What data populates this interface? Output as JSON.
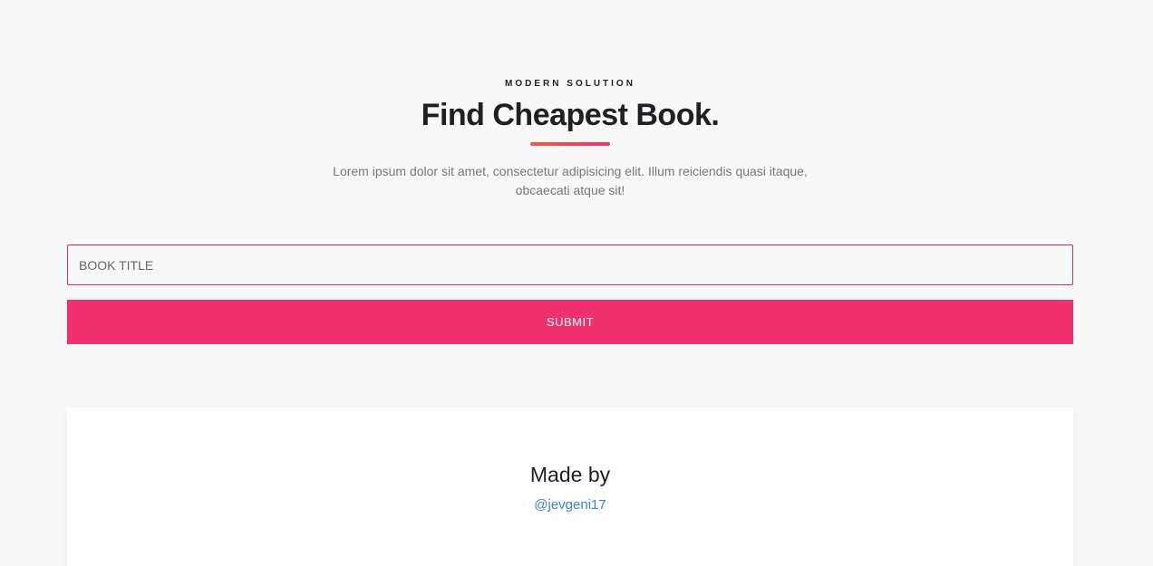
{
  "header": {
    "eyebrow": "MODERN SOLUTION",
    "title": "Find Cheapest Book.",
    "description": "Lorem ipsum dolor sit amet, consectetur adipisicing elit. Illum reiciendis quasi itaque, obcaecati atque sit!"
  },
  "form": {
    "book_title_placeholder": "BOOK TITLE",
    "book_title_value": "",
    "submit_label": "SUBMIT"
  },
  "footer": {
    "made_by": "Made by",
    "author_handle": "@jevgeni17"
  },
  "colors": {
    "accent": "#f0316d",
    "accent_gradient_start": "#f5593d",
    "input_border": "#c3306b",
    "link": "#3a7fd0",
    "background": "#f8f8f8"
  }
}
